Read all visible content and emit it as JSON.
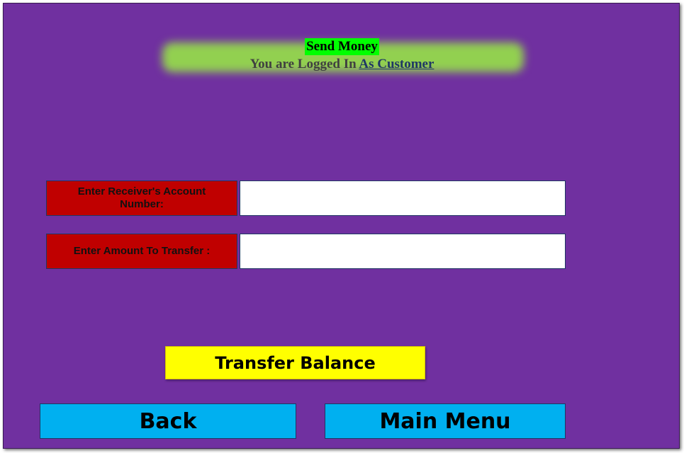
{
  "header": {
    "title": "Send Money",
    "logged_in_prefix": "You are Logged In",
    "logged_in_role": "As Customer"
  },
  "form": {
    "receiver_account": {
      "label": "Enter Receiver's Account Number:",
      "value": "",
      "placeholder": ""
    },
    "amount": {
      "label": "Enter Amount To Transfer :",
      "value": "",
      "placeholder": ""
    }
  },
  "buttons": {
    "transfer": "Transfer Balance",
    "back": "Back",
    "main_menu": "Main Menu"
  },
  "colors": {
    "background": "#7030a0",
    "header_glow": "#92d050",
    "title_highlight": "#00ff00",
    "label_bg": "#c00000",
    "transfer_button": "#ffff00",
    "nav_buttons": "#00b0f0"
  }
}
